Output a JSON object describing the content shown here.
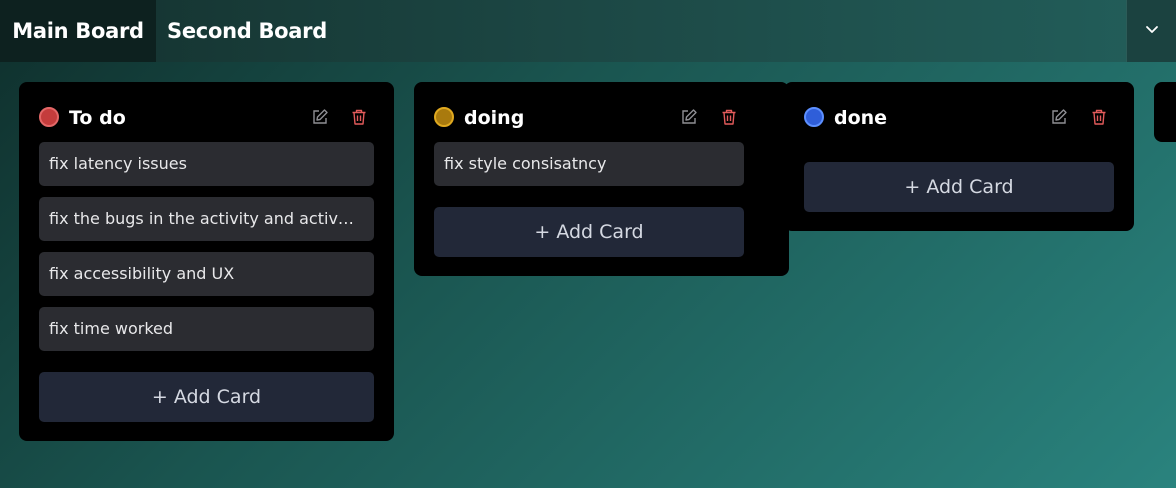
{
  "tabs": [
    {
      "label": "Main Board",
      "active": true
    },
    {
      "label": "Second Board",
      "active": false
    }
  ],
  "menu": {
    "icon": "chevron-down-icon"
  },
  "columns": [
    {
      "title": "To do",
      "dot_color": "#e46767",
      "dot_fill": "#c43c3c",
      "cards": [
        "fix latency issues",
        "fix the bugs in the activity and activtiy logging",
        "fix accessibility and UX",
        "fix time worked"
      ],
      "add_label": "+ Add Card"
    },
    {
      "title": "doing",
      "dot_color": "#e0a91f",
      "dot_fill": "#a97a0e",
      "cards": [
        "fix style consisatncy"
      ],
      "add_label": "+ Add Card"
    },
    {
      "title": "done",
      "dot_color": "#5c8fff",
      "dot_fill": "#2f5ed9",
      "cards": [],
      "add_label": "+ Add Card"
    }
  ],
  "colors": {
    "edit_icon": "#8f8f94",
    "delete_icon": "#e35b5b"
  }
}
